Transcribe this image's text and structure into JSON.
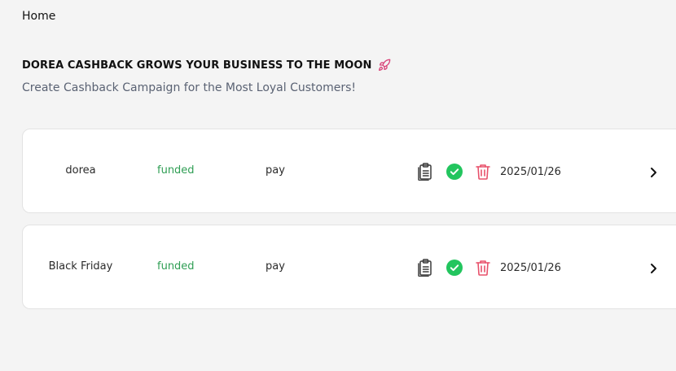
{
  "breadcrumb": {
    "home": "Home"
  },
  "hero": {
    "title": "DOREA CASHBACK GROWS YOUR BUSINESS TO THE MOON",
    "subtitle": "Create Cashback Campaign for the Most Loyal Customers!",
    "title_icon": "rocket-icon"
  },
  "campaigns": [
    {
      "name": "dorea",
      "status": "funded",
      "type": "pay",
      "date": "2025/01/26"
    },
    {
      "name": "Black Friday",
      "status": "funded",
      "type": "pay",
      "date": "2025/01/26"
    }
  ],
  "icons": {
    "copy": "clipboard-icon",
    "verified": "check-circle-icon",
    "delete": "trash-icon",
    "open": "chevron-right-icon"
  },
  "colors": {
    "background": "#f4f4f4",
    "status_funded": "#2f9e54",
    "check_green": "#22c55e",
    "trash_red": "#e8506a",
    "rocket": "#d9467a",
    "subtitle": "#5a6273"
  }
}
